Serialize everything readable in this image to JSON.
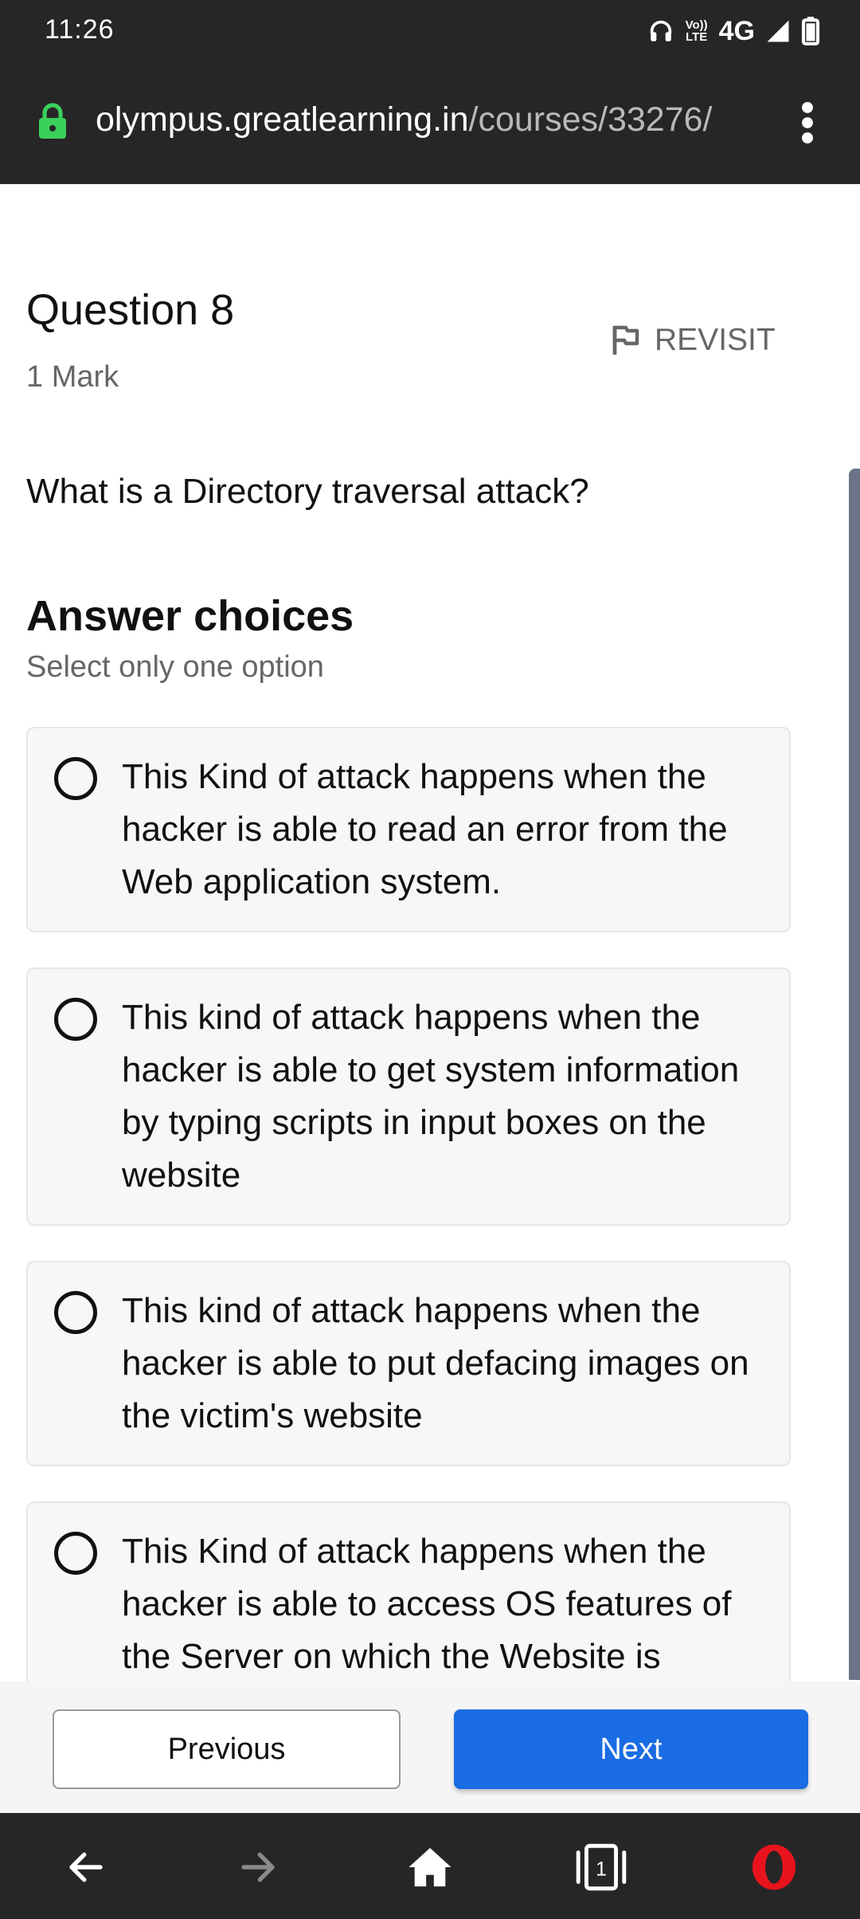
{
  "status_bar": {
    "time": "11:26",
    "network": "4G",
    "volte_top": "Vo))",
    "volte_bottom": "LTE"
  },
  "url_bar": {
    "domain": "olympus.greatlearning.in",
    "path": "/courses/33276/"
  },
  "question": {
    "title": "Question 8",
    "marks": "1 Mark",
    "revisit_label": "REVISIT",
    "text": "What is a Directory traversal attack?"
  },
  "answers": {
    "title": "Answer choices",
    "subtitle": "Select only one option",
    "choices": [
      {
        "text": "This Kind of attack happens when the hacker is able to read an error from the Web application system."
      },
      {
        "text": "This kind of attack happens when the hacker is able to get system information by typing scripts in input boxes on the website"
      },
      {
        "text": "This kind of attack happens when the hacker is able to put defacing images on the victim's website"
      },
      {
        "text": "This Kind of attack happens when the hacker is able to access OS features of the Server on which the Website is Running"
      }
    ]
  },
  "footer": {
    "previous_label": "Previous",
    "next_label": "Next"
  },
  "nav": {
    "tab_count": "1"
  },
  "colors": {
    "accent": "#1a6ce3",
    "lock_green": "#3ad05a",
    "opera_red": "#e8131c",
    "bar_dark": "#262626"
  }
}
